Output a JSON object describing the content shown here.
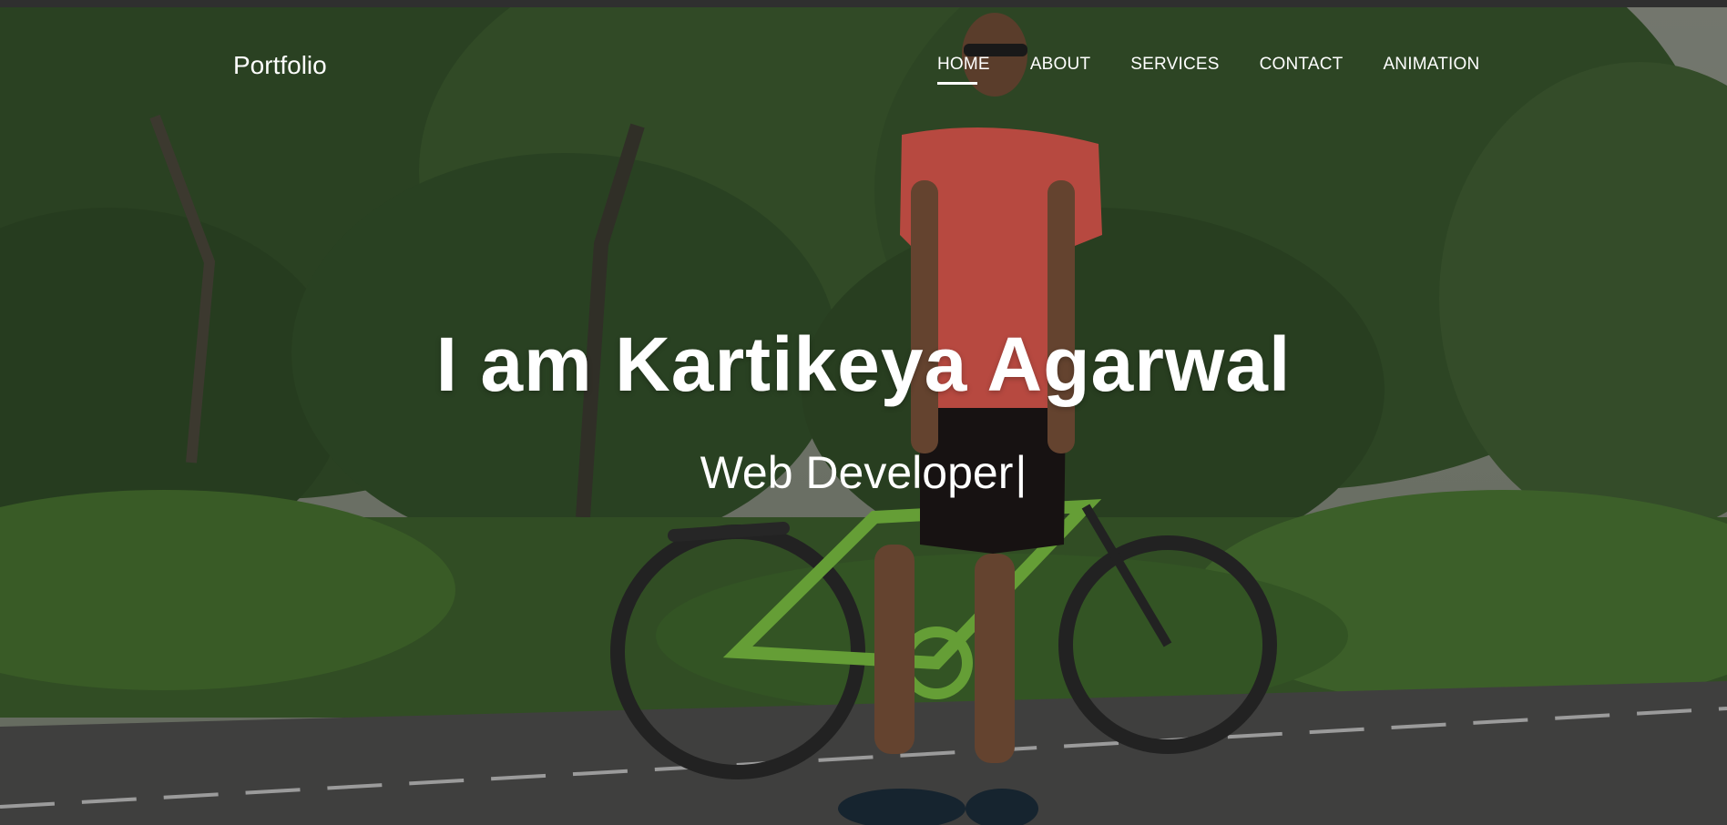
{
  "nav": {
    "brand": "Portfolio",
    "links": [
      {
        "label": "HOME",
        "active": true
      },
      {
        "label": "ABOUT",
        "active": false
      },
      {
        "label": "SERVICES",
        "active": false
      },
      {
        "label": "CONTACT",
        "active": false
      },
      {
        "label": "ANIMATION",
        "active": false
      }
    ]
  },
  "hero": {
    "title": "I am Kartikeya Agarwal",
    "subtitle": "Web Developer",
    "cursor": "|",
    "background": "photo of a person in a red t-shirt standing beside a green bicycle in front of trees"
  },
  "colors": {
    "text": "#ffffff",
    "foliage": "#3e5232",
    "shirt": "#e05a4f",
    "bicycle": "#7cc142",
    "road": "#4d4d4b"
  }
}
